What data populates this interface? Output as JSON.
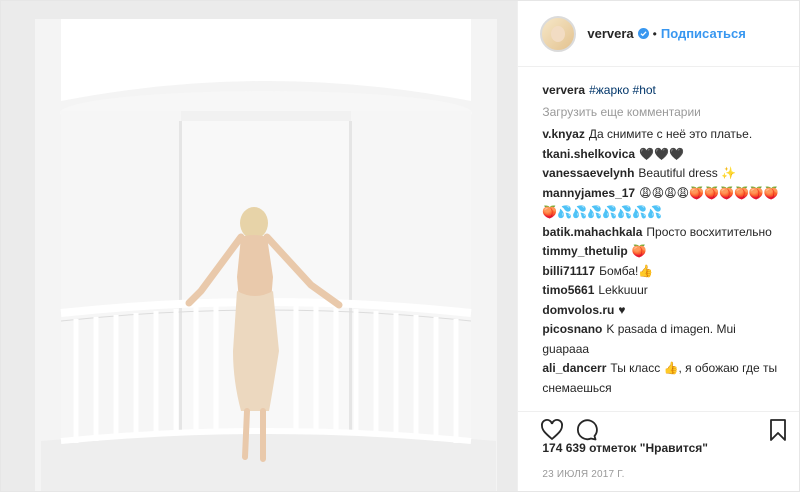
{
  "profile": {
    "username": "ververa",
    "separator": "•",
    "follow_label": "Подписаться"
  },
  "caption": {
    "username": "ververa",
    "hashtags": "#жарко #hot"
  },
  "load_more_label": "Загрузить еще комментарии",
  "comments": [
    {
      "user": "v.knyaz",
      "text": "Да снимите с неё это платье."
    },
    {
      "user": "tkani.shelkovica",
      "text": "🖤🖤🖤"
    },
    {
      "user": "vanessaevelynh",
      "text": "Beautiful dress ✨"
    },
    {
      "user": "mannyjames_17",
      "text": "😩😩😩😩🍑🍑🍑🍑🍑🍑🍑💦💦💦💦💦💦💦"
    },
    {
      "user": "batik.mahachkala",
      "text": "Просто восхитительно"
    },
    {
      "user": "timmy_thetulip",
      "text": "🍑"
    },
    {
      "user": "billi71117",
      "text": "Бомба!👍"
    },
    {
      "user": "timo5661",
      "text": "Lekkuuur"
    },
    {
      "user": "domvolos.ru",
      "text": "♥"
    },
    {
      "user": "picosnano",
      "text": "K pasada d imagen. Mui guapaaa"
    },
    {
      "user": "ali_dancerr",
      "text": "Ты класс 👍, я обожаю где ты снемаешься"
    }
  ],
  "likes_text": "174 639 отметок \"Нравится\"",
  "date_text": "23 ИЮЛЯ 2017 Г.",
  "icons": {
    "like": "heart-icon",
    "comment": "comment-icon",
    "save": "bookmark-icon",
    "verified": "verified-badge-icon"
  },
  "colors": {
    "link": "#3897f0",
    "hashtag": "#003569",
    "muted": "#999999",
    "text": "#262626"
  }
}
